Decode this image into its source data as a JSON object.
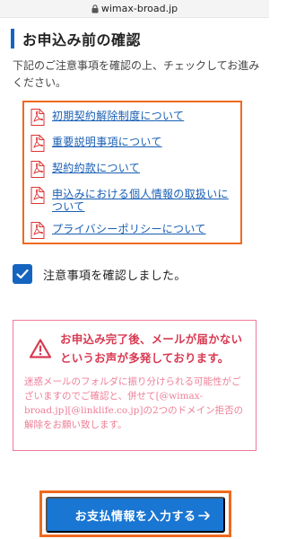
{
  "browser": {
    "url": "wimax-broad.jp"
  },
  "page": {
    "title": "お申込み前の確認",
    "intro": "下記のご注意事項を確認の上、チェックしてお進みください。"
  },
  "documents": [
    {
      "label": "初期契約解除制度について",
      "icon": "pdf-icon"
    },
    {
      "label": "重要説明事項について",
      "icon": "pdf-icon"
    },
    {
      "label": "契約約款について",
      "icon": "pdf-icon"
    },
    {
      "label": "申込みにおける個人情報の取扱いについて",
      "icon": "pdf-icon"
    },
    {
      "label": "プライバシーポリシーについて",
      "icon": "pdf-icon"
    }
  ],
  "confirm": {
    "label": "注意事項を確認しました。",
    "checked": true
  },
  "warning": {
    "title": "お申込み完了後、メールが届かないというお声が多発しております。",
    "body": "迷惑メールのフォルダに振り分けられる可能性がございますのでご確認と、併せて[@wimax-broad.jp][@linklife.co.jp]の2つのドメイン拒否の解除をお願い致します。",
    "icon": "warning-triangle-icon"
  },
  "cta": {
    "label": "お支払情報を入力する",
    "icon": "arrow-right-icon"
  },
  "colors": {
    "primary": "#1976d2",
    "highlight": "#ee6a1f",
    "warning": "#d83a52",
    "link": "#1a5fb4"
  }
}
